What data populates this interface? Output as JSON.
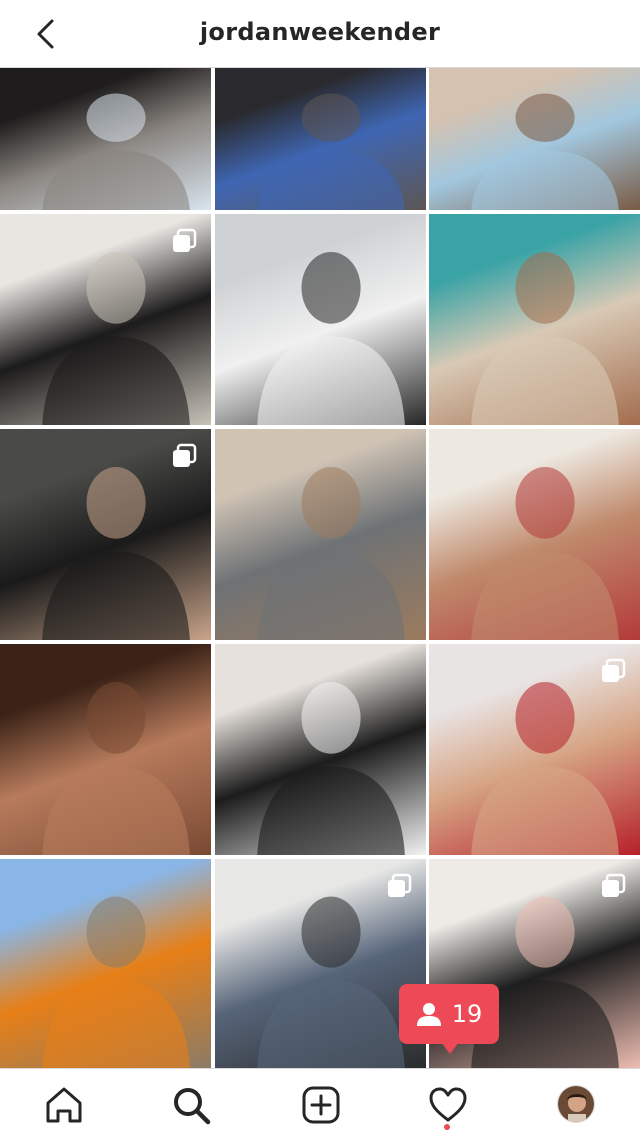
{
  "header": {
    "title": "jordanweekender",
    "back_icon": "chevron-left-icon"
  },
  "grid": {
    "posts": [
      {
        "name": "post-laptop",
        "multi": false,
        "colors": [
          "#1e1c1c",
          "#8a8580",
          "#d9e4ee"
        ]
      },
      {
        "name": "post-faded-flakes-tee",
        "multi": false,
        "colors": [
          "#2a2a2e",
          "#3f66b3",
          "#5d5654"
        ]
      },
      {
        "name": "post-couple-with-dog",
        "multi": false,
        "colors": [
          "#d5c2b0",
          "#a2c7de",
          "#7a5a44"
        ]
      },
      {
        "name": "post-faded-hoodie",
        "multi": true,
        "colors": [
          "#e9e6e2",
          "#1c1b1b",
          "#c8c2b8"
        ]
      },
      {
        "name": "post-space-jam-jersey",
        "multi": false,
        "colors": [
          "#cfd2d4",
          "#f0f0f0",
          "#272727"
        ]
      },
      {
        "name": "post-beach",
        "multi": false,
        "colors": [
          "#3aa3a6",
          "#d8c9b5",
          "#a36c4d"
        ]
      },
      {
        "name": "post-tiger-hoodie",
        "multi": true,
        "colors": [
          "#4a4a48",
          "#1a1a1a",
          "#c9a48a"
        ]
      },
      {
        "name": "post-mirror-selfie-grey-tracksuit",
        "multi": false,
        "colors": [
          "#cfc3b4",
          "#6e7275",
          "#9c7b5e"
        ]
      },
      {
        "name": "post-tongue-out-tv",
        "multi": false,
        "colors": [
          "#ede8e0",
          "#c08b6d",
          "#b33a3a"
        ]
      },
      {
        "name": "post-beer-bottle",
        "multi": false,
        "colors": [
          "#3b2317",
          "#b77b5c",
          "#7a4a33"
        ]
      },
      {
        "name": "post-skincare-products",
        "multi": false,
        "colors": [
          "#e6e1dc",
          "#1c1c1c",
          "#f2f2f2"
        ]
      },
      {
        "name": "post-red-jersey",
        "multi": true,
        "colors": [
          "#e9e4e4",
          "#d6a585",
          "#b6202a"
        ]
      },
      {
        "name": "post-orange-supercar",
        "multi": false,
        "colors": [
          "#89b6e6",
          "#e77f17",
          "#8b7b66"
        ]
      },
      {
        "name": "post-podcast-studio",
        "multi": true,
        "colors": [
          "#e7e7e5",
          "#57657a",
          "#2b2b2b"
        ]
      },
      {
        "name": "post-couple-pink-hoodie",
        "multi": true,
        "colors": [
          "#eeebe7",
          "#1e1e1e",
          "#edbdb2"
        ]
      }
    ]
  },
  "notification_badge": {
    "icon": "user-icon",
    "count": "19",
    "color": "#ed4956"
  },
  "bottom_nav": {
    "items": [
      {
        "name": "home-icon"
      },
      {
        "name": "search-icon"
      },
      {
        "name": "add-post-icon"
      },
      {
        "name": "heart-icon"
      },
      {
        "name": "profile-avatar"
      }
    ],
    "activity_dot_color": "#ed4956"
  }
}
